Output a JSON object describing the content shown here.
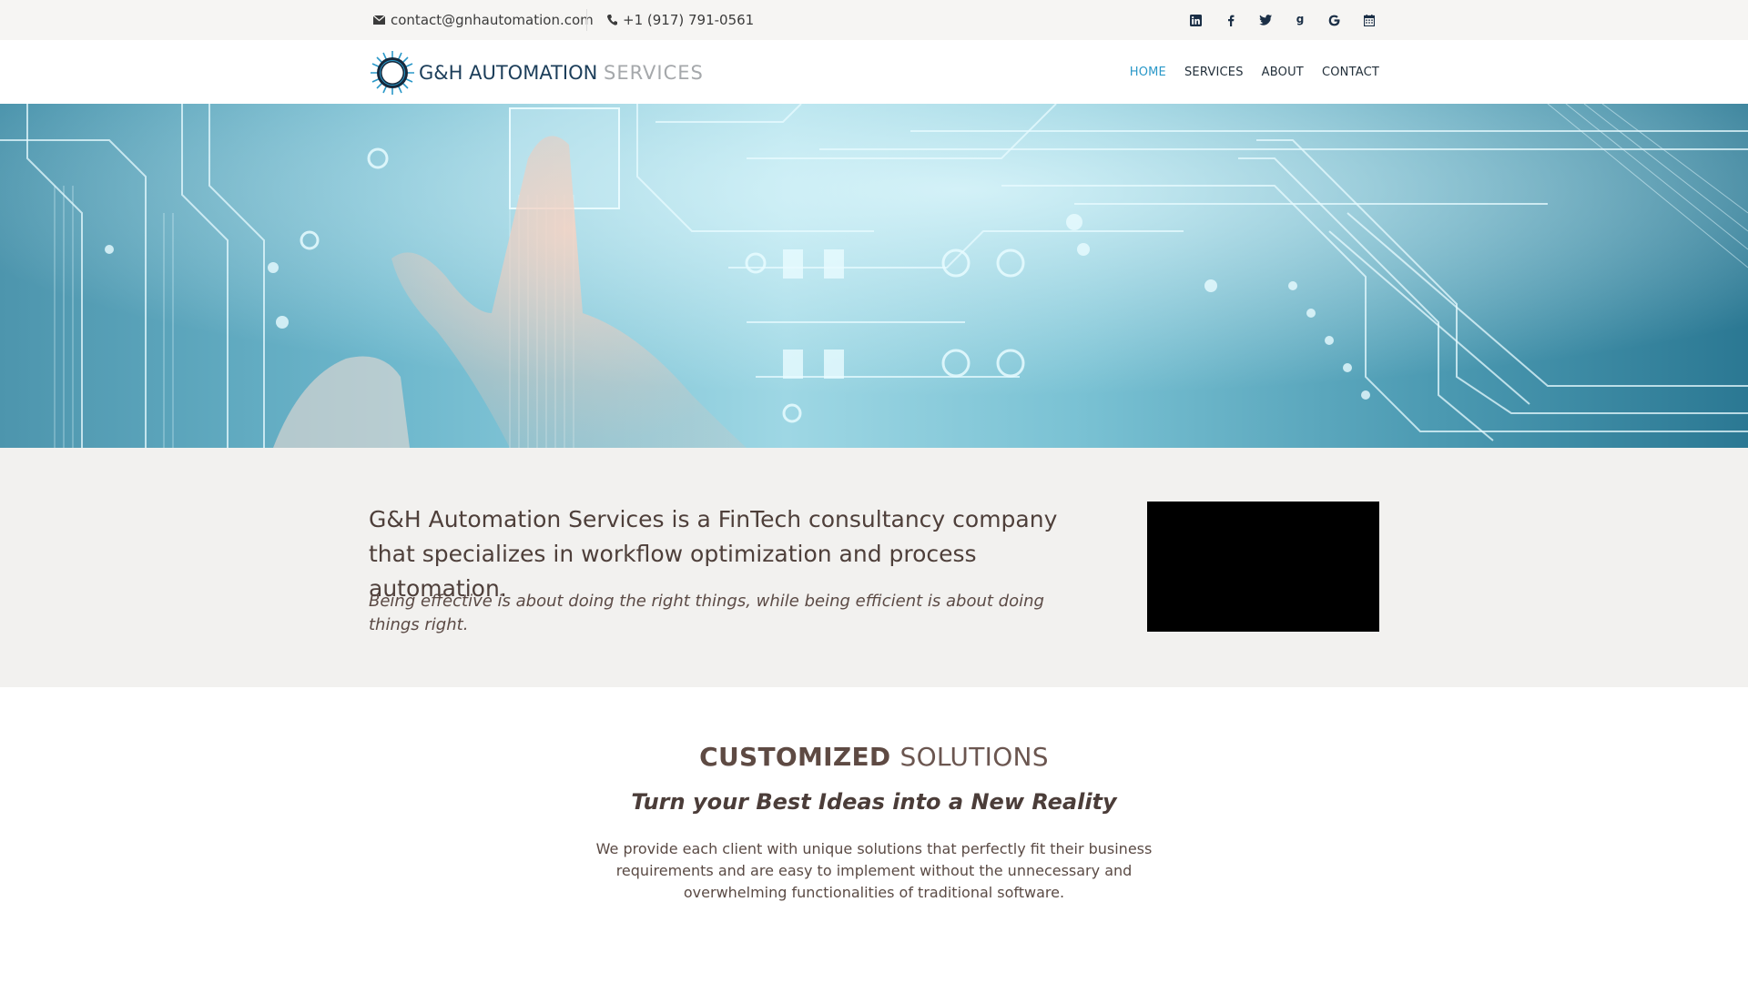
{
  "topbar": {
    "email": "contact@gnhautomation.com",
    "phone": "+1 (917) 791-0561",
    "social_icons": [
      "linkedin-icon",
      "facebook-icon",
      "twitter-icon",
      "google-plus-icon",
      "google-icon",
      "calendar-icon"
    ]
  },
  "header": {
    "logo_main": "G&H AUTOMATION",
    "logo_sub": "SERVICES",
    "nav": [
      {
        "label": "HOME",
        "active": true
      },
      {
        "label": "SERVICES",
        "active": false
      },
      {
        "label": "ABOUT",
        "active": false
      },
      {
        "label": "CONTACT",
        "active": false
      }
    ]
  },
  "intro": {
    "lead": "G&H Automation Services is a FinTech consultancy company that specializes in workflow optimization and process automation.",
    "quote": "Being effective is about doing the right things, while being efficient is about doing things right."
  },
  "solutions": {
    "heading_strong": "CUSTOMIZED",
    "heading_light": "SOLUTIONS",
    "subheading": "Turn your Best Ideas into a New Reality",
    "body": "We provide each client with unique solutions that perfectly fit their business requirements and are easy to implement without the unnecessary and overwhelming functionalities of traditional software."
  },
  "colors": {
    "accent": "#2a98c8",
    "topbar_bg": "#f6f5f3",
    "intro_bg": "#f2f1ef",
    "brand_text": "#1c3e5a"
  }
}
